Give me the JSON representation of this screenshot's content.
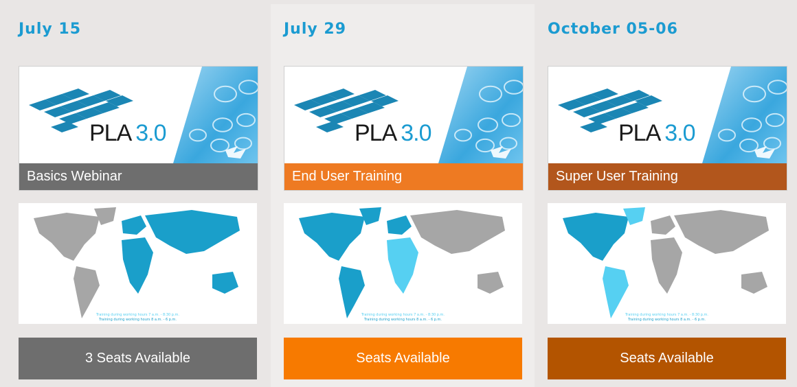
{
  "cards": [
    {
      "date": "July 15",
      "product": "PLA",
      "version": "3.0",
      "course": "Basics Webinar",
      "seats": "3 Seats Available",
      "accent": "#6e6e6e",
      "button_color": "#6e6e6e",
      "map_legend": [
        "Training during working hours 7 a.m. - 8:30 p.m.",
        "Training during working hours 8 a.m. - 6 p.m."
      ]
    },
    {
      "date": "July 29",
      "product": "PLA",
      "version": "3.0",
      "course": "End User Training",
      "seats": "Seats Available",
      "accent": "#ee7a22",
      "button_color": "#f77a00",
      "map_legend": [
        "Training during working hours 7 a.m. - 8:30 p.m.",
        "Training during working hours 8 a.m. - 6 p.m."
      ]
    },
    {
      "date": "October 05-06",
      "product": "PLA",
      "version": "3.0",
      "course": "Super User Training",
      "seats": "Seats Available",
      "accent": "#b2561c",
      "button_color": "#b35400",
      "map_legend": [
        "Training during working hours 7 a.m. - 8:30 p.m.",
        "Training during working hours 8 a.m. - 6 p.m."
      ]
    }
  ],
  "colors": {
    "date_text": "#1b9bd1",
    "map_gray": "#a6a6a6",
    "map_blue": "#1a9fca",
    "map_light_blue": "#56d0f2"
  }
}
